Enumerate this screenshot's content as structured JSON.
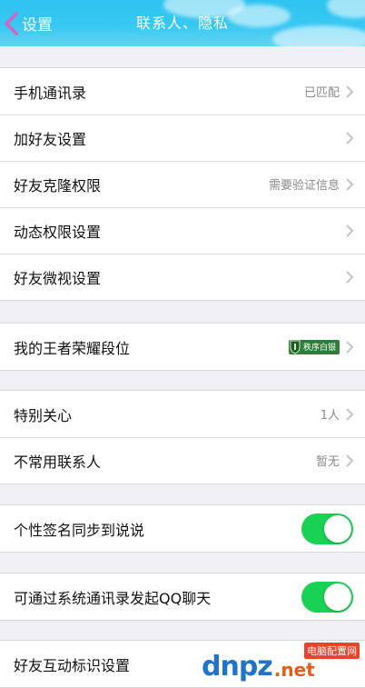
{
  "header": {
    "back_label": "设置",
    "title": "联系人、隐私"
  },
  "groups": [
    {
      "rows": [
        {
          "label": "手机通讯录",
          "value": "已匹配"
        },
        {
          "label": "加好友设置",
          "value": ""
        },
        {
          "label": "好友克隆权限",
          "value": "需要验证信息"
        },
        {
          "label": "动态权限设置",
          "value": ""
        },
        {
          "label": "好友微视设置",
          "value": ""
        }
      ]
    },
    {
      "rows": [
        {
          "label": "我的王者荣耀段位",
          "badge": "秩序白银"
        }
      ]
    },
    {
      "rows": [
        {
          "label": "特别关心",
          "value": "1人"
        },
        {
          "label": "不常用联系人",
          "value": "暂无"
        }
      ]
    },
    {
      "rows": [
        {
          "label": "个性签名同步到说说",
          "toggle": true
        }
      ]
    },
    {
      "rows": [
        {
          "label": "可通过系统通讯录发起QQ聊天",
          "toggle": true
        }
      ]
    },
    {
      "rows": [
        {
          "label": "好友互动标识设置"
        }
      ]
    }
  ],
  "watermark": {
    "text": "dnpz",
    "suffix": ".net",
    "brand": "电脑配置网"
  },
  "colors": {
    "nav_bg": "#37c8f3",
    "toggle_on": "#19d255",
    "back_arrow": "#c86cc8"
  }
}
